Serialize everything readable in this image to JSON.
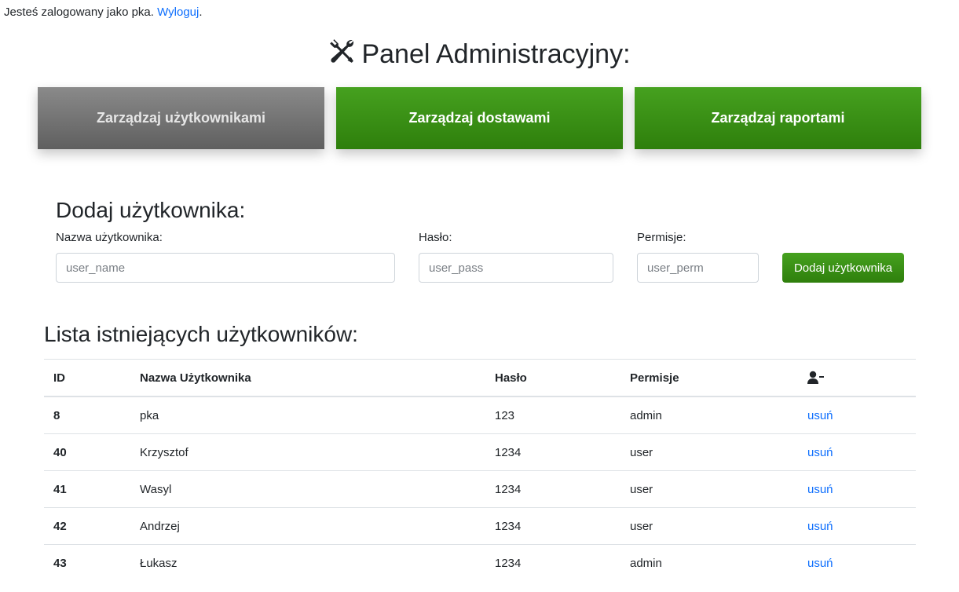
{
  "login": {
    "prefix": "Jesteś zalogowany jako pka.",
    "logout_label": "Wyloguj",
    "suffix": "."
  },
  "header": {
    "title": "Panel Administracyjny:"
  },
  "nav": [
    {
      "label": "Zarządzaj użytkownikami",
      "active": true
    },
    {
      "label": "Zarządzaj dostawami"
    },
    {
      "label": "Zarządzaj raportami"
    }
  ],
  "add_user": {
    "title": "Dodaj użytkownika:",
    "username_label": "Nazwa użytkownika:",
    "username_placeholder": "user_name",
    "password_label": "Hasło:",
    "password_placeholder": "user_pass",
    "permissions_label": "Permisje:",
    "permissions_placeholder": "user_perm",
    "submit_label": "Dodaj użytkownika"
  },
  "user_list": {
    "title": "Lista istniejących użytkowników:",
    "columns": [
      "ID",
      "Nazwa Użytkownika",
      "Hasło",
      "Permisje"
    ],
    "action_icon": "user-minus-icon",
    "rows": [
      {
        "id": "8",
        "name": "pka",
        "password": "123",
        "permissions": "admin",
        "action": "usuń"
      },
      {
        "id": "40",
        "name": "Krzysztof",
        "password": "1234",
        "permissions": "user",
        "action": "usuń"
      },
      {
        "id": "41",
        "name": "Wasyl",
        "password": "1234",
        "permissions": "user",
        "action": "usuń"
      },
      {
        "id": "42",
        "name": "Andrzej",
        "password": "1234",
        "permissions": "user",
        "action": "usuń"
      },
      {
        "id": "43",
        "name": "Łukasz",
        "password": "1234",
        "permissions": "admin",
        "action": "usuń"
      }
    ]
  },
  "colors": {
    "accent_green": "#2e7f0c",
    "inactive_gray": "#6b6b6b",
    "link_blue": "#0d6efd"
  }
}
